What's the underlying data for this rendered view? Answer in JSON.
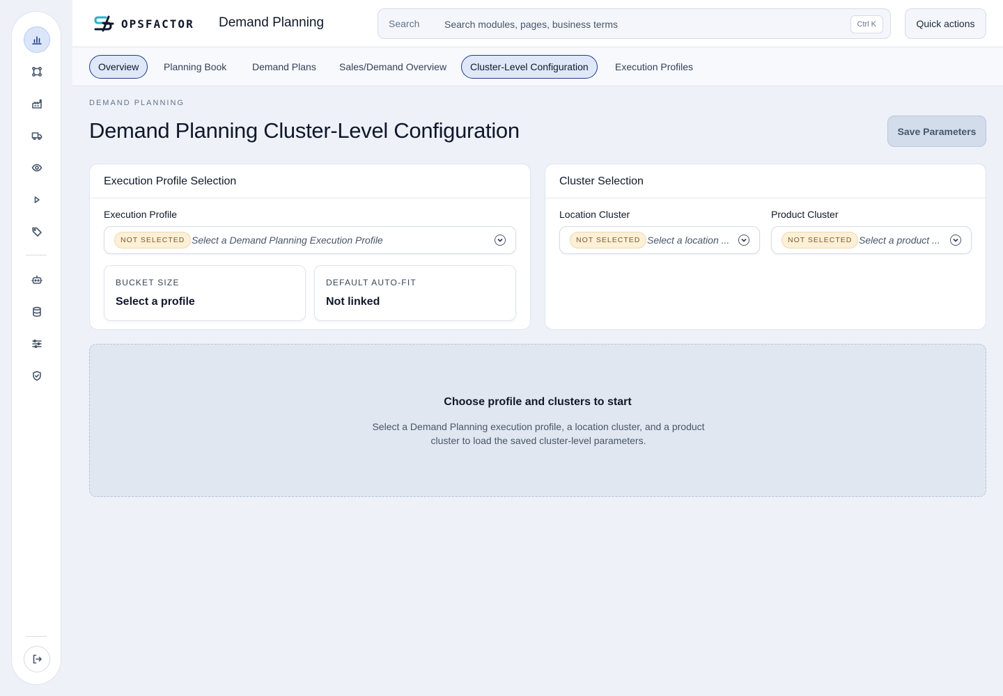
{
  "brand": {
    "name": "OPSFACTOR"
  },
  "header": {
    "app_title": "Demand Planning",
    "search_label": "Search",
    "search_placeholder": "Search modules, pages, business terms",
    "search_shortcut": "Ctrl K",
    "quick_actions": "Quick actions"
  },
  "rail": {
    "items": [
      {
        "icon": "bar-chart-icon",
        "active": true
      },
      {
        "icon": "network-icon",
        "active": false
      },
      {
        "icon": "factory-icon",
        "active": false
      },
      {
        "icon": "truck-icon",
        "active": false
      },
      {
        "icon": "eye-icon",
        "active": false
      },
      {
        "icon": "play-icon",
        "active": false
      },
      {
        "icon": "tag-icon",
        "active": false
      },
      {
        "icon": "robot-icon",
        "active": false
      },
      {
        "icon": "database-icon",
        "active": false
      },
      {
        "icon": "sliders-icon",
        "active": false
      },
      {
        "icon": "shield-check-icon",
        "active": false
      },
      {
        "icon": "logout-icon",
        "active": false
      }
    ]
  },
  "tabs": [
    {
      "label": "Overview",
      "selected": true
    },
    {
      "label": "Planning Book",
      "selected": false
    },
    {
      "label": "Demand Plans",
      "selected": false
    },
    {
      "label": "Sales/Demand Overview",
      "selected": false
    },
    {
      "label": "Cluster-Level Configuration",
      "selected": true
    },
    {
      "label": "Execution Profiles",
      "selected": false
    }
  ],
  "page": {
    "eyebrow": "DEMAND PLANNING",
    "title": "Demand Planning Cluster-Level Configuration",
    "save_button": "Save Parameters"
  },
  "execution_card": {
    "title": "Execution Profile Selection",
    "field_label": "Execution Profile",
    "badge": "NOT SELECTED",
    "select_text": "Select a Demand Planning Execution Profile",
    "stats": [
      {
        "label": "BUCKET SIZE",
        "value": "Select a profile"
      },
      {
        "label": "DEFAULT AUTO-FIT",
        "value": "Not linked"
      }
    ]
  },
  "cluster_card": {
    "title": "Cluster Selection",
    "location": {
      "label": "Location Cluster",
      "badge": "NOT SELECTED",
      "select_text": "Select a location ..."
    },
    "product": {
      "label": "Product Cluster",
      "badge": "NOT SELECTED",
      "select_text": "Select a product ..."
    }
  },
  "empty_state": {
    "title": "Choose profile and clusters to start",
    "body": "Select a Demand Planning execution profile, a location cluster, and a product cluster to load the saved cluster-level parameters."
  },
  "colors": {
    "accent": "#1e3a8a",
    "badge_bg": "#fdf0d9",
    "background": "#eef1f8"
  }
}
